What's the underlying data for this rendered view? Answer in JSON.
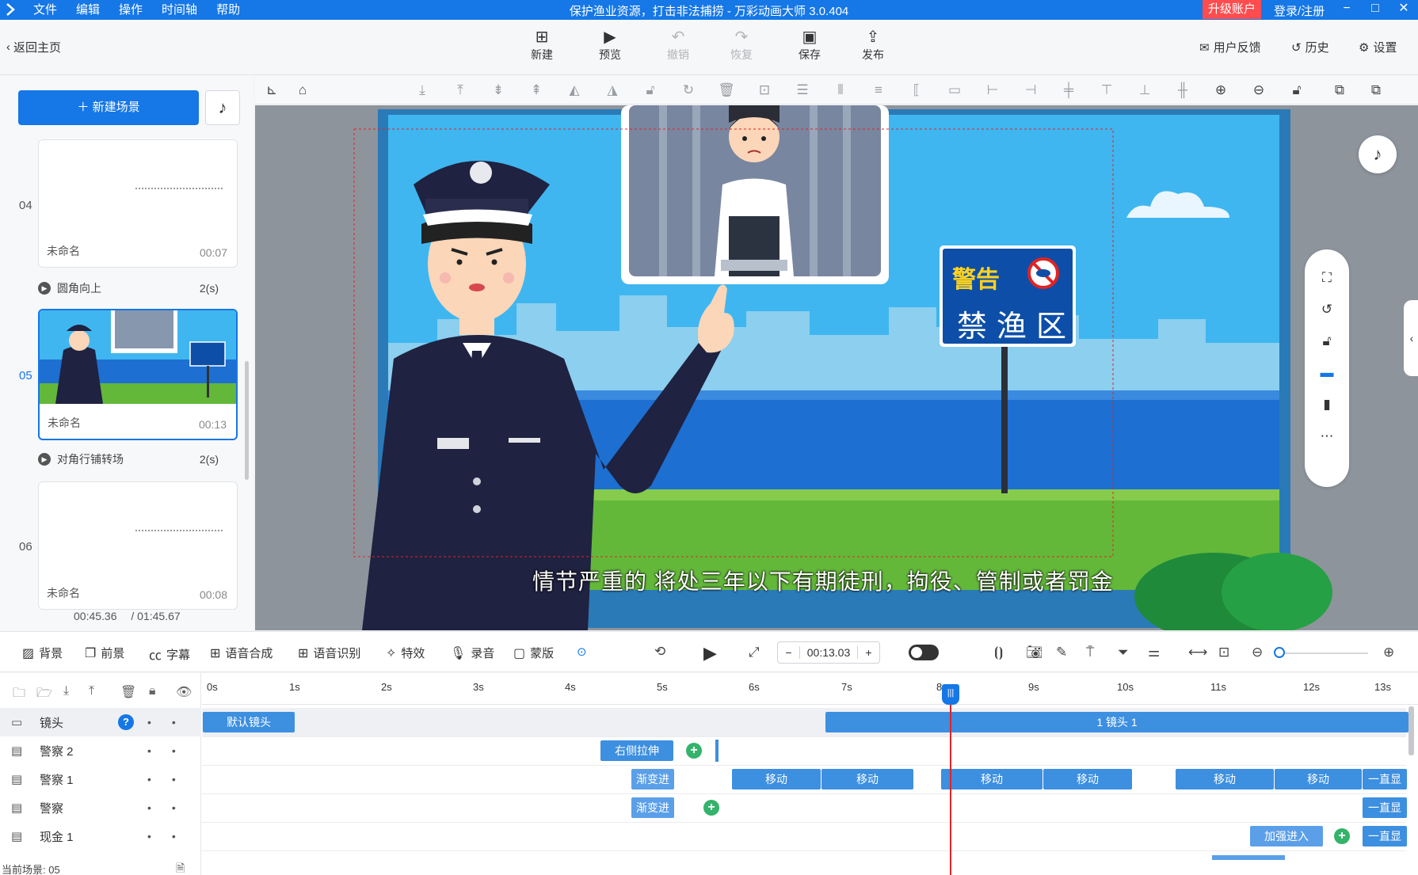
{
  "titlebar": {
    "menu": [
      "文件",
      "编辑",
      "操作",
      "时间轴",
      "帮助"
    ],
    "title": "保护渔业资源，打击非法捕捞 - 万彩动画大师 3.0.404",
    "upgrade": "升级账户",
    "login": "登录/注册"
  },
  "toolbar": {
    "back": "返回主页",
    "tools": [
      {
        "label": "新建",
        "icon": "plus-square-icon"
      },
      {
        "label": "预览",
        "icon": "play-icon"
      },
      {
        "label": "撤销",
        "icon": "undo-icon"
      },
      {
        "label": "恢复",
        "icon": "redo-icon"
      },
      {
        "label": "保存",
        "icon": "save-icon"
      },
      {
        "label": "发布",
        "icon": "publish-icon"
      }
    ],
    "feedback": "用户反馈",
    "history": "历史",
    "settings": "设置"
  },
  "scenes": {
    "new_scene": "新建场景",
    "items": [
      {
        "number": "04",
        "name": "未命名",
        "duration": "00:07",
        "selected": false
      },
      {
        "number": "05",
        "name": "未命名",
        "duration": "00:13",
        "selected": true
      },
      {
        "number": "06",
        "name": "未命名",
        "duration": "00:08",
        "selected": false
      }
    ],
    "transitions": [
      {
        "name": "圆角向上",
        "duration": "2(s)"
      },
      {
        "name": "对角行铺转场",
        "duration": "2(s)"
      }
    ],
    "current_time": "00:45.36",
    "total_time": "/ 01:45.67"
  },
  "stage": {
    "sign_warning": "警告",
    "sign_zone": "禁渔区",
    "subtitle": "情节严重的 将处三年以下有期徒刑，拘役、管制或者罚金",
    "colors": {
      "sky": "#3fb6f0",
      "sea": "#1d6fd2",
      "grass": "#63b83a",
      "uniform": "#1f2240",
      "sign": "#0d4fa8"
    }
  },
  "timeline_toolbar": {
    "items": [
      "背景",
      "前景",
      "字幕",
      "语音合成",
      "语音识别",
      "特效",
      "录音",
      "蒙版"
    ],
    "time": "00:13.03",
    "minus": "−",
    "plus": "+"
  },
  "timeline": {
    "ticks": [
      "0s",
      "1s",
      "2s",
      "3s",
      "4s",
      "5s",
      "6s",
      "7s",
      "8",
      "9s",
      "10s",
      "11s",
      "12s",
      "13s"
    ],
    "tracks": [
      {
        "name": "镜头"
      },
      {
        "name": "警察 2"
      },
      {
        "name": "警察 1"
      },
      {
        "name": "警察"
      },
      {
        "name": "现金 1"
      }
    ],
    "segments": {
      "camera_default": "默认镜头",
      "camera_1": "1 镜头 1",
      "p2_stretch": "右侧拉伸",
      "p1_fade": "渐变进",
      "p1_move1": "移动",
      "p1_move2": "移动",
      "p1_move3": "移动",
      "p1_move4": "移动",
      "p1_move5": "移动",
      "p1_move6": "移动",
      "p1_always": "一直显",
      "p_fade": "渐变进",
      "p_always": "一直显",
      "cash_in": "加强进入",
      "cash_always": "一直显"
    },
    "current_scene": "当前场景: 05"
  }
}
